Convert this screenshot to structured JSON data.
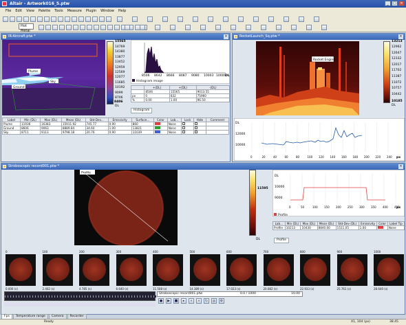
{
  "window": {
    "title": "Altair - Artwork016_5.ptw"
  },
  "menu": [
    "File",
    "Edit",
    "View",
    "Palette",
    "Tools",
    "Measure",
    "Plugin",
    "Window",
    "Help"
  ],
  "toolbar": {
    "palette_value": "Hot Metal"
  },
  "colors": {
    "titlebar": "#2b57ad",
    "panel_title": "#4a78c4",
    "thermal_hot": "#f7e26b",
    "thermal_cold": "#2a0505",
    "profile_blue": "#1e5aa8",
    "profile_red": "#e04040",
    "histogram": "#2a1040"
  },
  "panel_ir": {
    "title": "IR-Aircraft.ptw *",
    "scale_max": "15565",
    "scale_labels": [
      "14769",
      "14380",
      "13877",
      "13452",
      "12959",
      "12569",
      "12077",
      "11685",
      "10192",
      "9099",
      "8706"
    ],
    "scale_min": "8406",
    "scale_unit": "DL",
    "labels": [
      "Plume",
      "Sky",
      "Ground"
    ],
    "histogram_xticks": [
      "8506",
      "8642",
      "8666",
      "8087",
      "9080",
      "10003",
      "10009"
    ],
    "histogram_unit": "DL",
    "histogram_legend": "Histogram image",
    "histogram_button": "Histogram",
    "stats_headers": [
      "",
      "+(DL)",
      "+(DL)",
      "-(DL)"
    ],
    "stats_rows": [
      [
        "",
        "8506",
        "15565",
        "9013.55"
      ],
      [
        "px",
        "0",
        "832",
        "75960"
      ],
      [
        "%",
        "0.00",
        "1.00",
        "96.50"
      ]
    ],
    "table_headers": [
      "Label",
      "Min (DL)",
      "Max (DL)",
      "Mean (DL)",
      "Std-Dev...",
      "Emissivity",
      "Surface...",
      "Color",
      "Lab...",
      "Lock",
      "Hide",
      "Comment"
    ],
    "table_rows": [
      [
        "Plume",
        "11936",
        "16383",
        "15911.92",
        "745.77",
        "0.90",
        "860",
        "",
        "None",
        "",
        "",
        ""
      ],
      [
        "Ground",
        "8606",
        "9063",
        "8889.84",
        "34.60",
        "1.00",
        "13821",
        "",
        "None",
        "",
        "",
        ""
      ],
      [
        "Sky",
        "8711",
        "9113",
        "9798.18",
        "20.76",
        "0.90",
        "11039",
        "",
        "None",
        "",
        "",
        ""
      ]
    ]
  },
  "panel_rocket": {
    "title": "RocketLaunch_Sq.ptw *",
    "annotation": "Rocket Engine",
    "scale_max": "13213",
    "scale_labels": [
      "12962",
      "12647",
      "12332",
      "12017",
      "11702",
      "11387",
      "11072",
      "10757",
      "10442"
    ],
    "scale_min": "10185",
    "scale_unit": "DL",
    "profile_yticks": [
      "DL",
      "12000",
      "10000"
    ],
    "profile_xticks": [
      "0",
      "20",
      "40",
      "60",
      "80",
      "100",
      "120",
      "140",
      "160",
      "180",
      "200",
      "220",
      "240"
    ],
    "profile_unit": "px"
  },
  "panel_strobo": {
    "title": "Stroboscopic record001.ptw *",
    "profile_label": "Profile",
    "scale_max": "11595",
    "scale_unit": "DL",
    "profile_yticks": [
      "DL",
      "10000",
      "9000"
    ],
    "profile_xticks": [
      "0",
      "50",
      "100",
      "150",
      "200",
      "250",
      "300",
      "350",
      "400",
      "450"
    ],
    "profile_unit": "px",
    "profile_legend": "Profile",
    "table_headers": [
      "Lab...",
      "Min (DL)",
      "Max (DL)",
      "Mean (DL)",
      "Std-Dev (DL)",
      "Emissivity",
      "Color",
      "Label Tip"
    ],
    "table_rows": [
      [
        "Profile",
        "10213",
        "10430",
        "8840.00",
        "1511.05",
        "1.00",
        "",
        "None"
      ]
    ],
    "profile_tab": "Profile",
    "frame_ticks": [
      "0",
      "100",
      "200",
      "300",
      "400",
      "500",
      "600",
      "700",
      "800",
      "900",
      "1000"
    ],
    "frame_times": [
      "0.000 (s)",
      "2.402 (s)",
      "4.785 (s)",
      "6.640 (s)",
      "11.508 (s)",
      "14.389 (s)",
      "17.023 (s)",
      "20.082 (s)",
      "22.933 (s)",
      "25.761 (s)",
      "28.640 (s)"
    ],
    "player_file": "Stroboscopic record001.ptw",
    "player_frames": "0.0 / 1000",
    "player_fps": "10.00"
  },
  "bottom_tabs": [
    "Fps",
    "Temperature range",
    "Camera",
    "Recorder"
  ],
  "status": {
    "left": "Ready",
    "pos": "X1, 104 (px)",
    "val": "38.45"
  }
}
